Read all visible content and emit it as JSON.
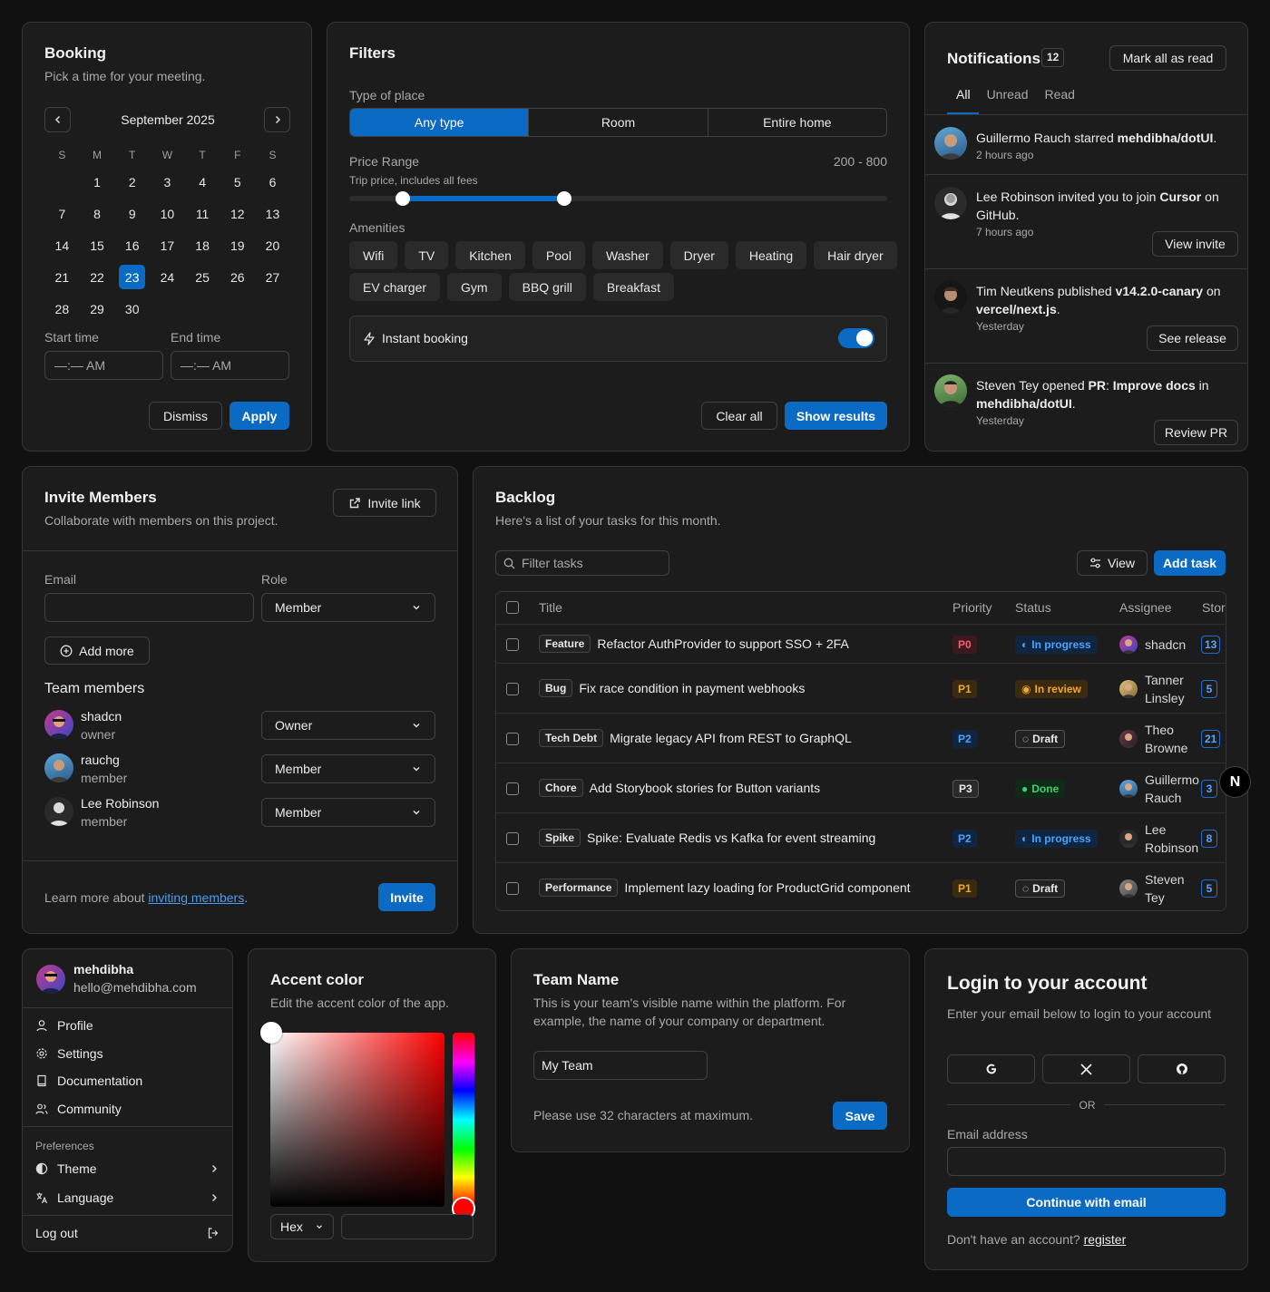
{
  "booking": {
    "title": "Booking",
    "subtitle": "Pick a time for your meeting.",
    "month": "September 2025",
    "weekdays": [
      "S",
      "M",
      "T",
      "W",
      "T",
      "F",
      "S"
    ],
    "days": [
      "",
      "1",
      "2",
      "3",
      "4",
      "5",
      "6",
      "7",
      "8",
      "9",
      "10",
      "11",
      "12",
      "13",
      "14",
      "15",
      "16",
      "17",
      "18",
      "19",
      "20",
      "21",
      "22",
      "23",
      "24",
      "25",
      "26",
      "27",
      "28",
      "29",
      "30"
    ],
    "selected_day": "23",
    "start_label": "Start time",
    "end_label": "End time",
    "start_value": "—:— AM",
    "end_value": "—:— AM",
    "dismiss": "Dismiss",
    "apply": "Apply"
  },
  "filters": {
    "title": "Filters",
    "type_label": "Type of place",
    "types": [
      "Any type",
      "Room",
      "Entire home"
    ],
    "selected_type": "Any type",
    "price_label": "Price Range",
    "price_hint": "Trip price, includes all fees",
    "price_value": "200 - 800",
    "price_min": 200,
    "price_max": 800,
    "amenities_label": "Amenities",
    "amenities_row1": [
      "Wifi",
      "TV",
      "Kitchen",
      "Pool",
      "Washer",
      "Dryer",
      "Heating",
      "Hair dryer"
    ],
    "amenities_row2": [
      "EV charger",
      "Gym",
      "BBQ grill",
      "Breakfast"
    ],
    "instant_label": "Instant booking",
    "instant_on": true,
    "clear": "Clear all",
    "show": "Show results"
  },
  "notifications": {
    "title": "Notifications",
    "count": "12",
    "mark_all": "Mark all as read",
    "tabs": [
      "All",
      "Unread",
      "Read"
    ],
    "items": [
      {
        "pre": "Guillermo Rauch starred ",
        "bold": "mehdibha/dotUI",
        "post": ".",
        "time": "2 hours ago",
        "action": ""
      },
      {
        "pre": "Lee Robinson invited you to join ",
        "bold": "Cursor",
        "post": " on GitHub.",
        "time": "7 hours ago",
        "action": "View invite"
      },
      {
        "pre": "Tim Neutkens published ",
        "bold": "v14.2.0-canary",
        "mid": " on ",
        "bold2": "vercel/next.js",
        "post": ".",
        "time": "Yesterday",
        "action": "See release"
      },
      {
        "pre": "Steven Tey opened ",
        "bold": "PR",
        "mid": ": ",
        "bold2": "Improve docs",
        "mid2": " in ",
        "bold3": "mehdibha/dotUI",
        "post": ".",
        "time": "Yesterday",
        "action": "Review PR"
      }
    ]
  },
  "invite": {
    "title": "Invite Members",
    "subtitle": "Collaborate with members on this project.",
    "invite_link": "Invite link",
    "email_label": "Email",
    "role_label": "Role",
    "role_value": "Member",
    "add_more": "Add more",
    "team_label": "Team members",
    "members": [
      {
        "name": "shadcn",
        "role": "owner",
        "select": "Owner"
      },
      {
        "name": "rauchg",
        "role": "member",
        "select": "Member"
      },
      {
        "name": "Lee Robinson",
        "role": "member",
        "select": "Member"
      }
    ],
    "footer_pre": "Learn more about ",
    "footer_link": "inviting members",
    "footer_post": ".",
    "invite_btn": "Invite"
  },
  "backlog": {
    "title": "Backlog",
    "subtitle": "Here's a list of your tasks for this month.",
    "filter_placeholder": "Filter tasks",
    "view": "View",
    "add_task": "Add task",
    "columns": [
      "Title",
      "Priority",
      "Status",
      "Assignee",
      "Stor"
    ],
    "rows": [
      {
        "tag": "Feature",
        "title": "Refactor AuthProvider to support SSO + 2FA",
        "priority": "P0",
        "status": "In progress",
        "assignee1": "shadcn",
        "assignee2": "",
        "points": "13"
      },
      {
        "tag": "Bug",
        "title": "Fix race condition in payment webhooks",
        "priority": "P1",
        "status": "In review",
        "assignee1": "Tanner",
        "assignee2": "Linsley",
        "points": "5"
      },
      {
        "tag": "Tech Debt",
        "title": "Migrate legacy API from REST to GraphQL",
        "priority": "P2",
        "status": "Draft",
        "assignee1": "Theo",
        "assignee2": "Browne",
        "points": "21"
      },
      {
        "tag": "Chore",
        "title": "Add Storybook stories for Button variants",
        "priority": "P3",
        "status": "Done",
        "assignee1": "Guillermo",
        "assignee2": "Rauch",
        "points": "3"
      },
      {
        "tag": "Spike",
        "title": "Spike: Evaluate Redis vs Kafka for event streaming",
        "priority": "P2",
        "status": "In progress",
        "assignee1": "Lee",
        "assignee2": "Robinson",
        "points": "8"
      },
      {
        "tag": "Performance",
        "title": "Implement lazy loading for ProductGrid component",
        "priority": "P1",
        "status": "Draft",
        "assignee1": "Steven",
        "assignee2": "Tey",
        "points": "5"
      }
    ]
  },
  "account": {
    "name": "mehdibha",
    "email": "hello@mehdibha.com",
    "items": [
      "Profile",
      "Settings",
      "Documentation",
      "Community"
    ],
    "pref_label": "Preferences",
    "theme": "Theme",
    "language": "Language",
    "logout": "Log out"
  },
  "accent": {
    "title": "Accent color",
    "subtitle": "Edit the accent color of the app.",
    "format": "Hex",
    "value": ""
  },
  "team": {
    "title": "Team Name",
    "description": "This is your team's visible name within the platform. For example, the name of your company or department.",
    "value": "My Team",
    "hint": "Please use 32 characters at maximum.",
    "save": "Save"
  },
  "login": {
    "title": "Login to your account",
    "subtitle": "Enter your email below to login to your account",
    "or": "OR",
    "email_label": "Email address",
    "continue": "Continue with email",
    "footer_pre": "Don't have an account? ",
    "register": "register"
  },
  "colors": {
    "accent": "#0b6bc4",
    "background": "#111111",
    "card": "#1c1c1c"
  },
  "floating_badge": "N"
}
